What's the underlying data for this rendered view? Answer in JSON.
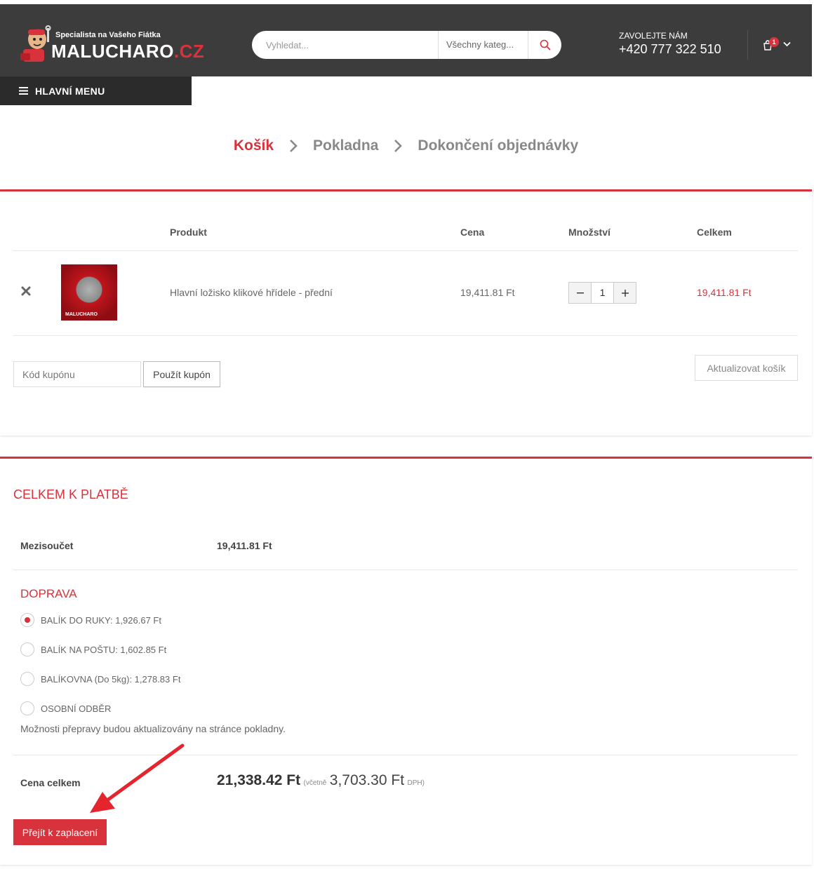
{
  "header": {
    "logo_tagline": "Specialista na Vašeho Fiátka",
    "logo_brand_main": "MALUCHARO",
    "logo_brand_suffix": ".CZ",
    "search_placeholder": "Vyhledat...",
    "search_category": "Všechny kateg...",
    "call_label": "ZAVOLEJTE NÁM",
    "call_phone": "+420 777 322 510",
    "cart_count": "1",
    "main_menu_label": "HLAVNÍ MENU",
    "accent_color": "#d8333c"
  },
  "steps": [
    {
      "label": "Košík",
      "active": true
    },
    {
      "label": "Pokladna",
      "active": false
    },
    {
      "label": "Dokončení objednávky",
      "active": false
    }
  ],
  "cart": {
    "columns": {
      "product": "Produkt",
      "price": "Cena",
      "quantity": "Množství",
      "total": "Celkem"
    },
    "items": [
      {
        "name": "Hlavní ložisko klikové hřídele - přední",
        "price": "19,411.81 Ft",
        "quantity": "1",
        "total": "19,411.81 Ft",
        "thumb_brand": "MALUCHARO"
      }
    ],
    "coupon_placeholder": "Kód kupónu",
    "apply_coupon": "Použít kupón",
    "update_cart": "Aktualizovat košík"
  },
  "totals": {
    "title": "CELKEM K PLATBĚ",
    "subtotal_label": "Mezisoučet",
    "subtotal_value": "19,411.81 Ft",
    "shipping_title": "DOPRAVA",
    "shipping_options": [
      {
        "label": "BALÍK DO RUKY: 1,926.67 Ft",
        "checked": true
      },
      {
        "label": "BALÍK NA POŠTU: 1,602.85 Ft",
        "checked": false
      },
      {
        "label": "BALÍKOVNA (Do 5kg): 1,278.83 Ft",
        "checked": false
      },
      {
        "label": "OSOBNÍ ODBĚR",
        "checked": false
      }
    ],
    "shipping_note": "Možnosti přepravy budou aktualizovány na stránce pokladny.",
    "grand_label": "Cena celkem",
    "grand_amount": "21,338.42 Ft",
    "grand_incl": "(včetně",
    "grand_tax": "3,703.30 Ft",
    "grand_tax_suffix": "DPH)",
    "checkout_button": "Přejít k zaplacení"
  }
}
